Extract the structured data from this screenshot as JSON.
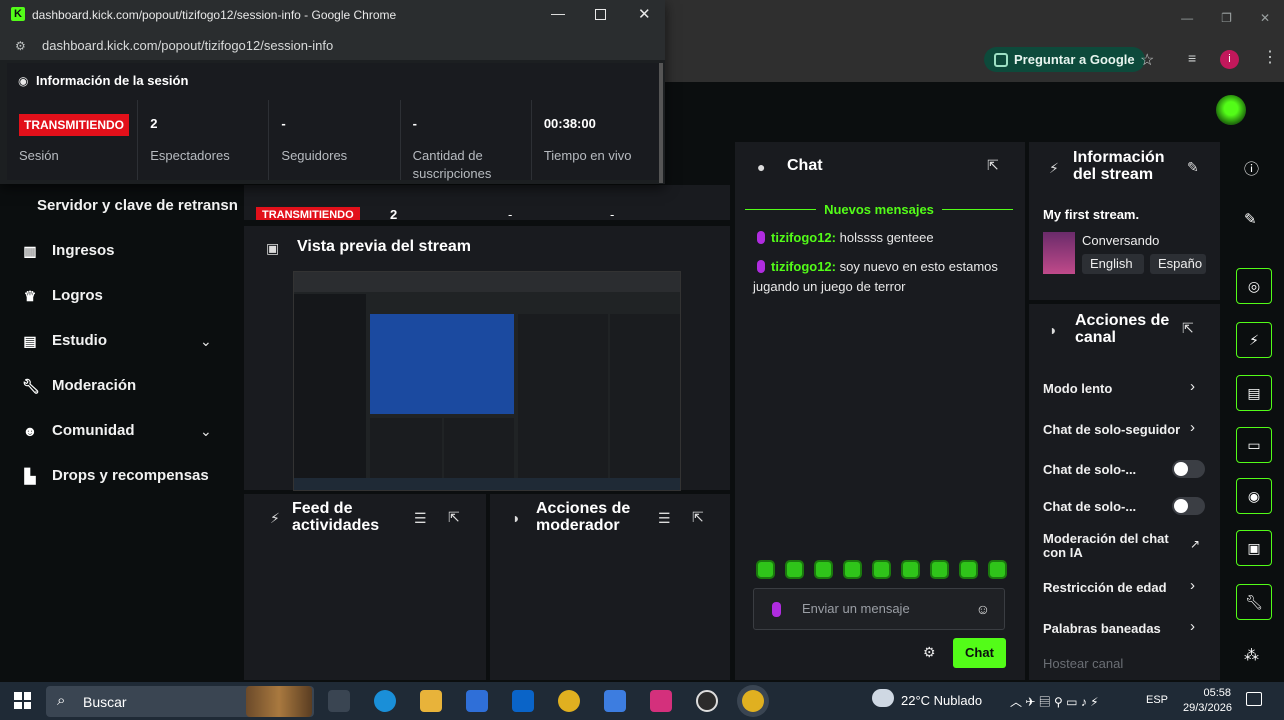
{
  "browser_bg": {
    "ask_google": "Preguntar a Google"
  },
  "popout": {
    "title": "dashboard.kick.com/popout/tizifogo12/session-info - Google Chrome",
    "url": "dashboard.kick.com/popout/tizifogo12/session-info",
    "header": "Información de la sesión",
    "stats": [
      {
        "value": "",
        "label": "Sesión",
        "badge": "TRANSMITIENDO"
      },
      {
        "value": "2",
        "label": "Espectadores"
      },
      {
        "value": "-",
        "label": "Seguidores"
      },
      {
        "value": "-",
        "label": "Cantidad de suscripciones"
      },
      {
        "value": "00:38:00",
        "label": "Tiempo en vivo"
      }
    ]
  },
  "nav": {
    "server_key": "Servidor y clave de retransn",
    "items": [
      {
        "label": "Ingresos",
        "icon": "chart-icon"
      },
      {
        "label": "Logros",
        "icon": "trophy-icon"
      },
      {
        "label": "Estudio",
        "icon": "studio-icon"
      },
      {
        "label": "Moderación",
        "icon": "wrench-icon"
      },
      {
        "label": "Comunidad",
        "icon": "community-icon"
      },
      {
        "label": "Drops y recompensas",
        "icon": "drops-icon"
      }
    ]
  },
  "strip": {
    "badge": "TRANSMITIENDO",
    "viewers": "2",
    "dash1": "-",
    "dash2": "-"
  },
  "preview": {
    "title": "Vista previa del stream"
  },
  "feed": {
    "title": "Feed de actividades"
  },
  "mod_actions": {
    "title": "Acciones de moderador"
  },
  "chat": {
    "title": "Chat",
    "new_messages": "Nuevos mensajes",
    "messages": [
      {
        "user": "tizifogo12:",
        "text": " holssss genteee"
      },
      {
        "user": "tizifogo12:",
        "text": " soy nuevo en esto estamos jugando un juego de terror"
      }
    ],
    "placeholder": "Enviar un mensaje",
    "send": "Chat"
  },
  "stream_info": {
    "title": "Información del stream",
    "stream_title": "My first stream.",
    "category": "Conversando",
    "tags": [
      "English",
      "Españo"
    ]
  },
  "channel_actions": {
    "title": "Acciones de canal",
    "rows": [
      {
        "label": "Modo lento",
        "control": "chevron"
      },
      {
        "label": "Chat de solo-seguidor",
        "control": "chevron"
      },
      {
        "label": "Chat de solo-...",
        "control": "toggle",
        "on": false
      },
      {
        "label": "Chat de solo-...",
        "control": "toggle",
        "on": false
      },
      {
        "label": "Moderación del chat con IA",
        "control": "external"
      },
      {
        "label": "Restricción de edad",
        "control": "chevron"
      },
      {
        "label": "Palabras baneadas",
        "control": "chevron"
      },
      {
        "label": "Hostear canal",
        "control": "none"
      }
    ]
  },
  "taskbar": {
    "search": "Buscar",
    "weather": "22°C  Nublado",
    "lang": "ESP",
    "time": "05:58",
    "date": "29/3/2026"
  },
  "colors": {
    "accent": "#53fc18",
    "live": "#e2101a",
    "panel": "#191b1f"
  }
}
